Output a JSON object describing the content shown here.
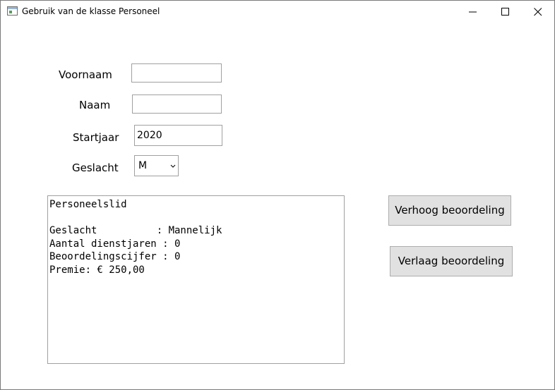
{
  "window": {
    "title": "Gebruik van de klasse Personeel"
  },
  "form": {
    "voornaam_label": "Voornaam",
    "voornaam_value": "",
    "naam_label": "Naam",
    "naam_value": "",
    "startjaar_label": "Startjaar",
    "startjaar_value": "2020",
    "geslacht_label": "Geslacht",
    "geslacht_value": "M"
  },
  "output": {
    "lines": [
      "Personeelslid",
      "",
      "Geslacht          : Mannelijk",
      "Aantal dienstjaren : 0",
      "Beoordelingscijfer : 0",
      "Premie: € 250,00"
    ]
  },
  "buttons": {
    "verhoog_label": "Verhoog beoordeling",
    "verlaag_label": "Verlaag beoordeling"
  },
  "icons": {
    "app": "window-app-icon",
    "minimize": "minimize-icon",
    "maximize": "maximize-icon",
    "close": "close-icon",
    "dropdown": "chevron-down-icon"
  }
}
